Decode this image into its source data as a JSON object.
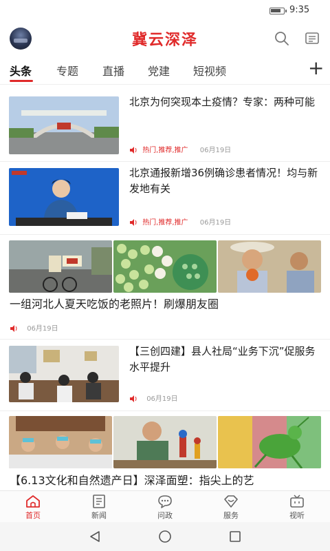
{
  "status_bar": {
    "time": "9:35"
  },
  "header": {
    "title": "冀云深泽"
  },
  "tabs": [
    {
      "label": "头条"
    },
    {
      "label": "专题"
    },
    {
      "label": "直播"
    },
    {
      "label": "党建"
    },
    {
      "label": "短视频"
    }
  ],
  "news": [
    {
      "title": "北京为何突现本土疫情？专家：两种可能",
      "tags": "热门,推荐,推广",
      "date": "06月19日"
    },
    {
      "title": "北京通报新增36例确诊患者情况！均与新发地有关",
      "tags": "热门,推荐,推广",
      "date": "06月19日"
    },
    {
      "title": "一组河北人夏天吃饭的老照片！刷爆朋友圈",
      "date": "06月19日"
    },
    {
      "title": "【三创四建】县人社局“业务下沉”促服务水平提升",
      "date": "06月19日"
    },
    {
      "title": "【6.13文化和自然遗产日】深泽面塑：指尖上的艺"
    }
  ],
  "bottom_nav": [
    {
      "label": "首页"
    },
    {
      "label": "新闻"
    },
    {
      "label": "问政"
    },
    {
      "label": "服务"
    },
    {
      "label": "视听"
    }
  ],
  "colors": {
    "accent": "#e02a2a"
  }
}
